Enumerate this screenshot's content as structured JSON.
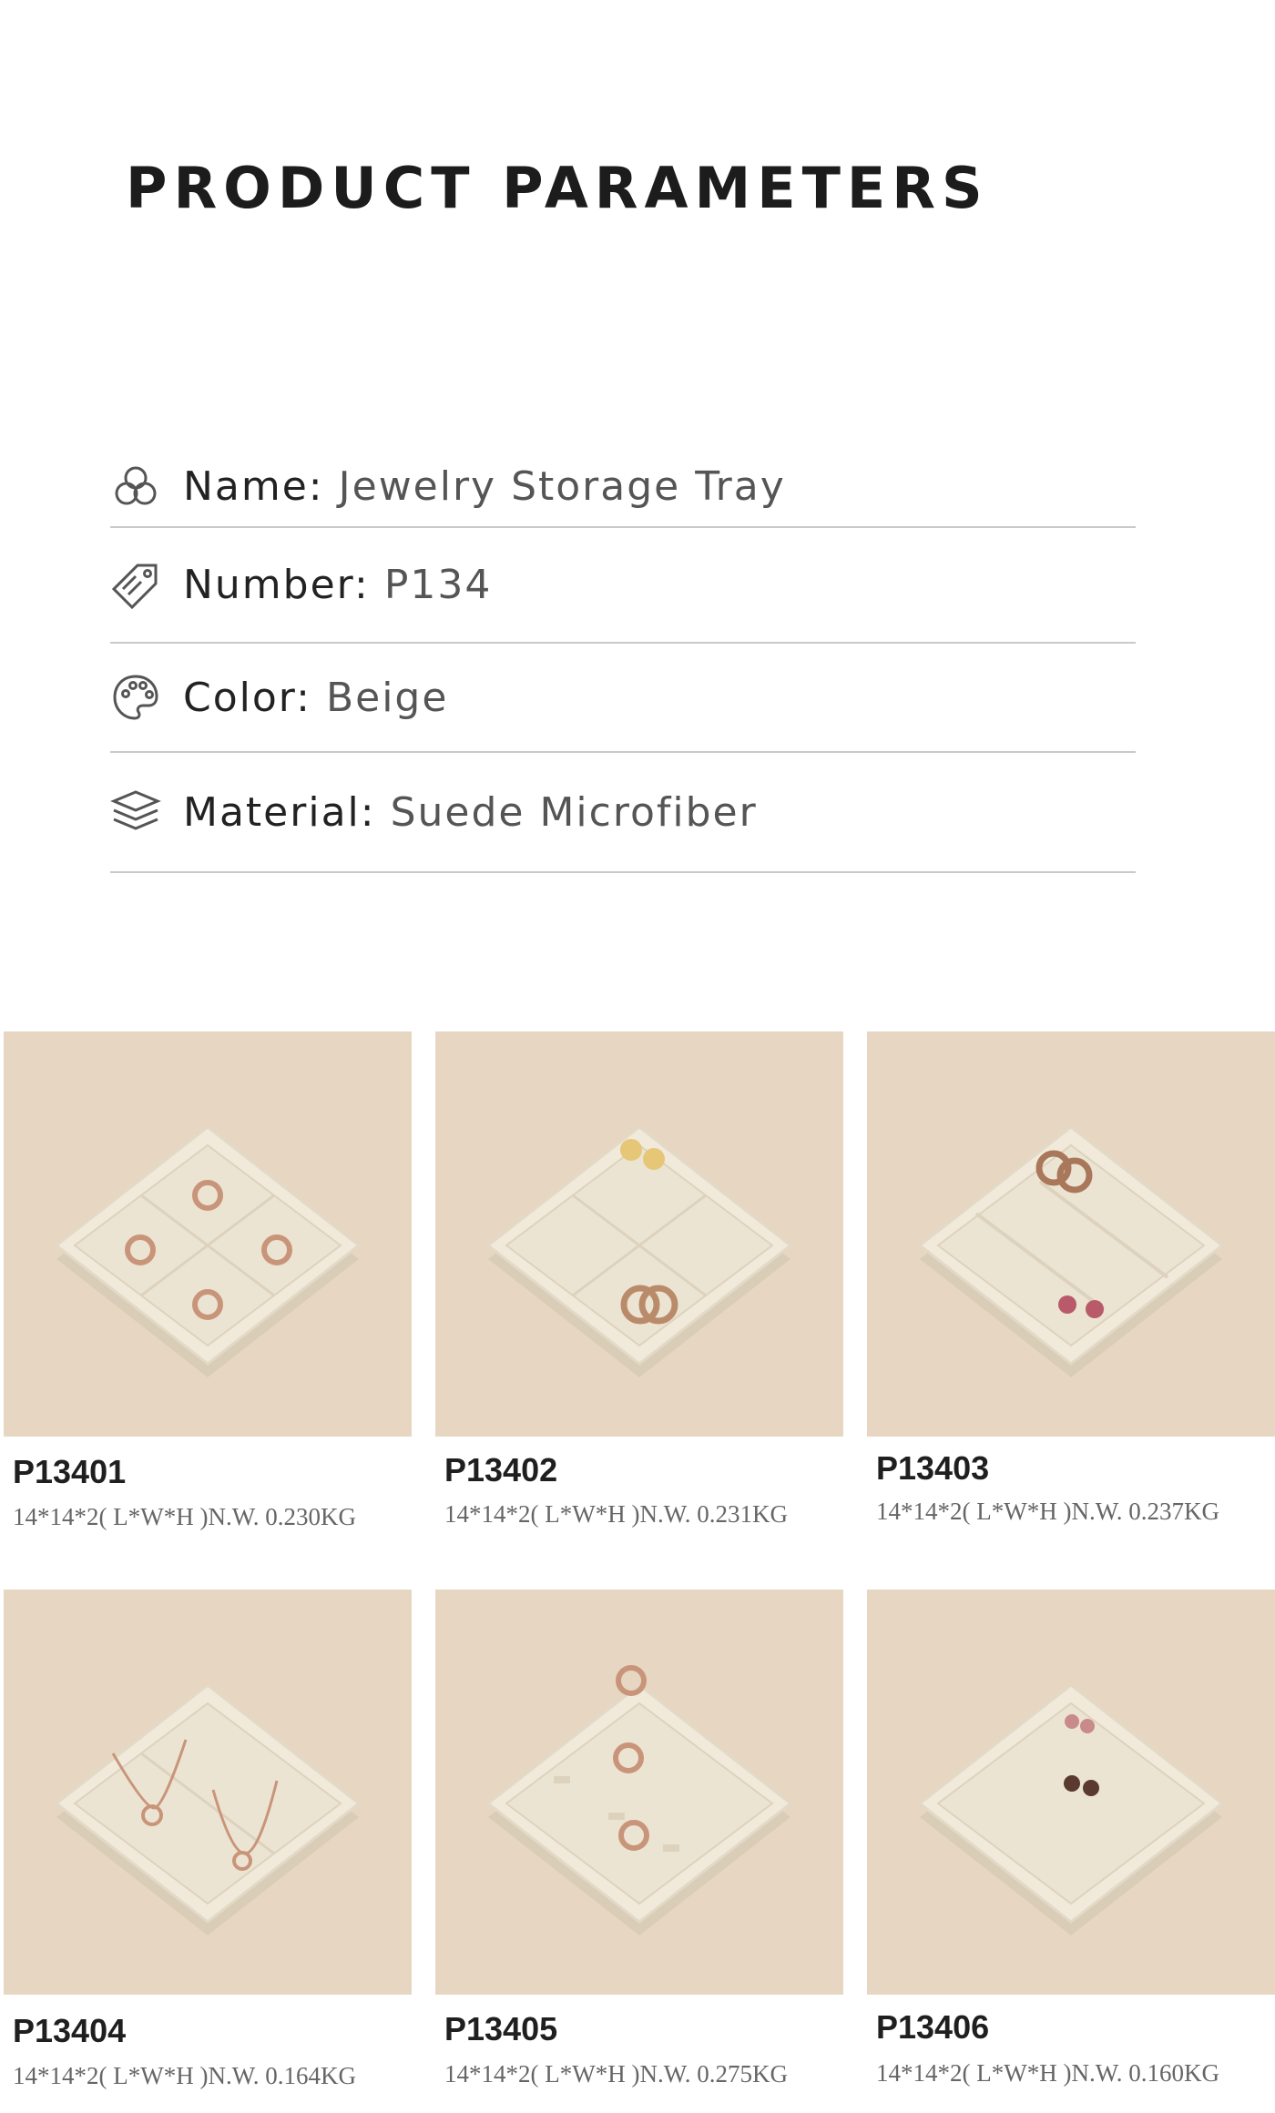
{
  "header": {
    "title": "PRODUCT PARAMETERS"
  },
  "params": [
    {
      "icon": "circles-icon",
      "label": "Name:",
      "value": "Jewelry Storage Tray"
    },
    {
      "icon": "price-tag-icon",
      "label": "Number:",
      "value": "P134"
    },
    {
      "icon": "palette-icon",
      "label": "Color:",
      "value": "Beige"
    },
    {
      "icon": "layers-icon",
      "label": "Material:",
      "value": "Suede Microfiber"
    }
  ],
  "products": [
    {
      "code": "P13401",
      "spec": "14*14*2( L*W*H )N.W. 0.230KG",
      "tray": "four-compartment",
      "items": "rings"
    },
    {
      "code": "P13402",
      "spec": "14*14*2( L*W*H )N.W. 0.231KG",
      "tray": "four-compartment",
      "items": "earrings"
    },
    {
      "code": "P13403",
      "spec": "14*14*2( L*W*H )N.W. 0.237KG",
      "tray": "multi-slot",
      "items": "earrings"
    },
    {
      "code": "P13404",
      "spec": "14*14*2( L*W*H )N.W. 0.164KG",
      "tray": "two-compartment",
      "items": "necklaces"
    },
    {
      "code": "P13405",
      "spec": "14*14*2( L*W*H )N.W. 0.275KG",
      "tray": "ring-slots",
      "items": "rings"
    },
    {
      "code": "P13406",
      "spec": "14*14*2( L*W*H )N.W. 0.160KG",
      "tray": "flat",
      "items": "earrings"
    }
  ],
  "colors": {
    "background": "#ffffff",
    "photo_backdrop": "#e7d7c2",
    "tray": "#efe8d8",
    "divider": "#c9c9c9"
  }
}
